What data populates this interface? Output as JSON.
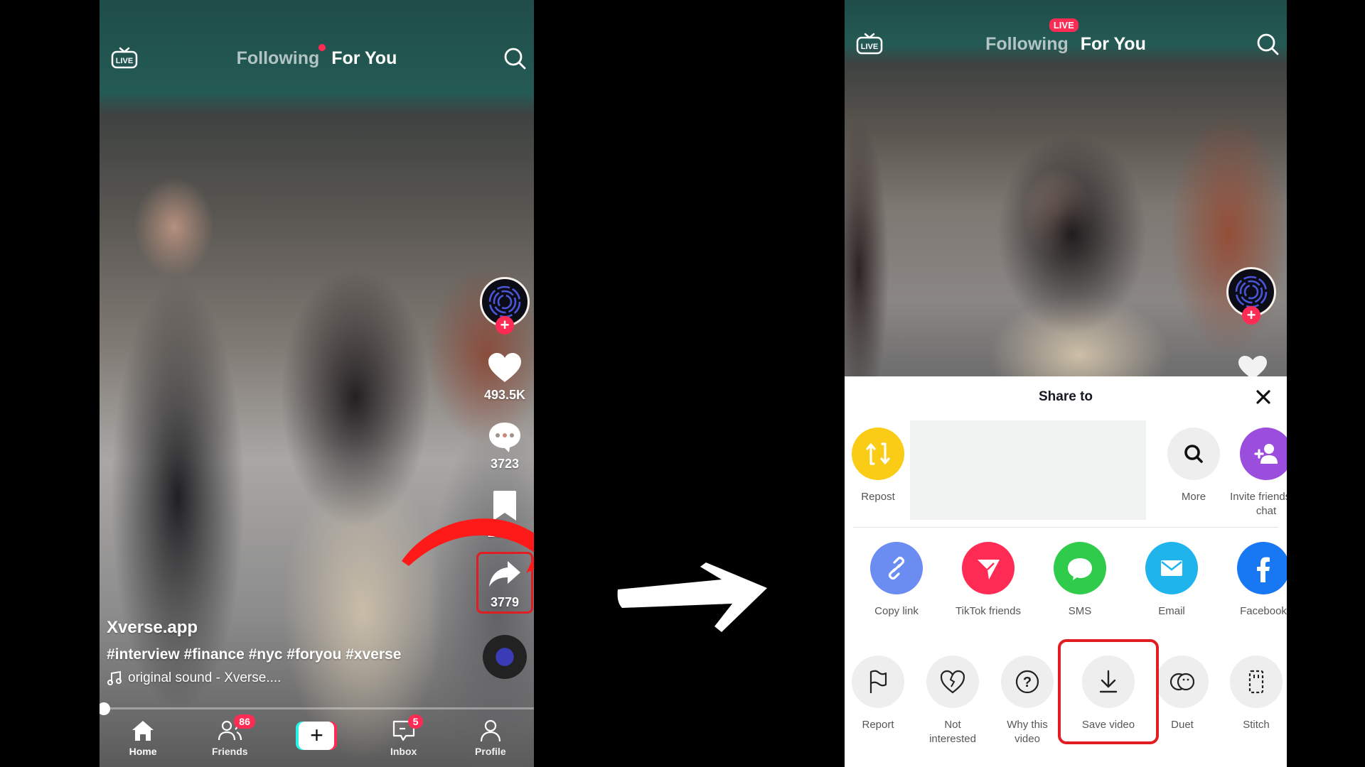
{
  "left_phone": {
    "topbar": {
      "live_icon": "live-tv-icon",
      "tab_following": "Following",
      "tab_for_you": "For You",
      "search_icon": "search-icon"
    },
    "creator": {
      "avatar_icon": "xverse-logo-icon",
      "follow_label": "+"
    },
    "actions": {
      "likes": "493.5K",
      "comments": "3723",
      "saves": "20.5K",
      "shares": "3779"
    },
    "caption": {
      "username": "Xverse.app",
      "hashtags": "#interview #finance #nyc #foryou #xverse",
      "sound": "original sound - Xverse...."
    },
    "progress": 0.01,
    "bottom_nav": [
      {
        "label": "Home",
        "icon": "home-icon",
        "active": true
      },
      {
        "label": "Friends",
        "icon": "friends-icon",
        "badge": "86"
      },
      {
        "label": "",
        "icon": "create-plus-icon",
        "create_symbol": "+"
      },
      {
        "label": "Inbox",
        "icon": "inbox-icon",
        "badge": "5"
      },
      {
        "label": "Profile",
        "icon": "profile-icon"
      }
    ],
    "annotation": {
      "highlight_color": "#e11d22",
      "arrow_color": "#ff1a1a"
    }
  },
  "right_phone": {
    "topbar": {
      "live_icon": "live-tv-icon",
      "tab_following": "Following",
      "live_badge": "LIVE",
      "tab_for_you": "For You",
      "search_icon": "search-icon"
    },
    "creator": {
      "follow_label": "+"
    },
    "share_sheet": {
      "title": "Share to",
      "close_icon": "close-icon",
      "row1": [
        {
          "label": "Repost",
          "icon": "repost-icon",
          "color": "#facc15"
        },
        {
          "label": "More",
          "icon": "search-icon",
          "color": "#eeeeee"
        },
        {
          "label": "Invite friends to chat",
          "icon": "invite-friend-icon",
          "color": "#9b4ddd"
        }
      ],
      "row2": [
        {
          "label": "Copy link",
          "icon": "link-icon",
          "color": "#6b8cf0"
        },
        {
          "label": "TikTok friends",
          "icon": "send-icon",
          "color": "#fe2c55"
        },
        {
          "label": "SMS",
          "icon": "message-bubble-icon",
          "color": "#2ecc4a"
        },
        {
          "label": "Email",
          "icon": "envelope-icon",
          "color": "#1fb5ec"
        },
        {
          "label": "Facebook",
          "icon": "facebook-icon",
          "color": "#1877f2"
        }
      ],
      "row3": [
        {
          "label": "Report",
          "icon": "flag-icon"
        },
        {
          "label": "Not interested",
          "icon": "broken-heart-icon"
        },
        {
          "label": "Why this video",
          "icon": "question-icon"
        },
        {
          "label": "Save video",
          "icon": "download-icon",
          "highlighted": true
        },
        {
          "label": "Duet",
          "icon": "duet-icon"
        },
        {
          "label": "Stitch",
          "icon": "stitch-icon"
        }
      ]
    }
  },
  "transition_arrow": {
    "icon": "right-arrow-icon",
    "color": "#ffffff"
  }
}
